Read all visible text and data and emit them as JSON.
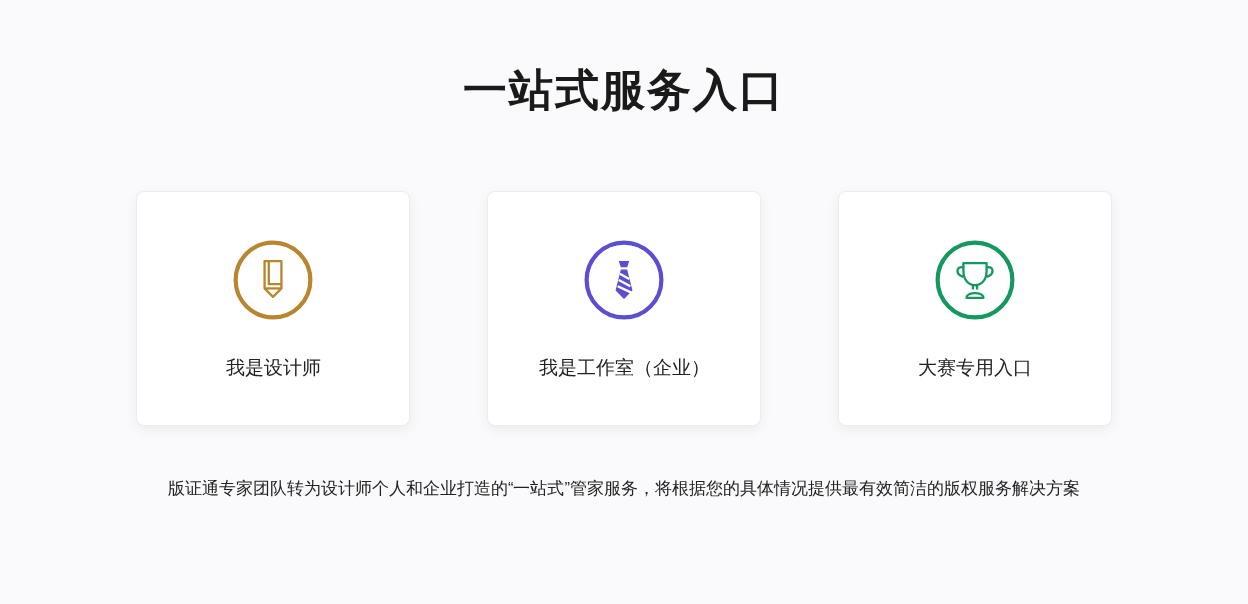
{
  "title": "一站式服务入口",
  "cards": [
    {
      "label": "我是设计师",
      "kind": "pencil",
      "color": "#b8862e"
    },
    {
      "label": "我是工作室（企业）",
      "kind": "tie",
      "color": "#5b4fd0"
    },
    {
      "label": "大赛专用入口",
      "kind": "trophy",
      "color": "#14985f"
    }
  ],
  "description": "版证通专家团队转为设计师个人和企业打造的“一站式”管家服务，将根据您的具体情况提供最有效简洁的版权服务解决方案"
}
